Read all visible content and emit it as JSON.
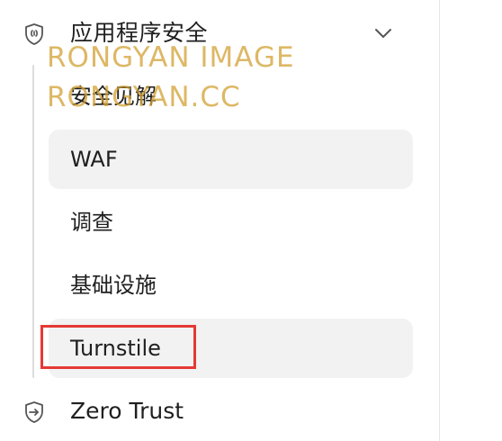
{
  "sidebar": {
    "section": {
      "title": "应用程序安全",
      "icon": "shield-icon",
      "expanded": true
    },
    "items": [
      {
        "label": "安全见解",
        "active": false
      },
      {
        "label": "WAF",
        "active": true
      },
      {
        "label": "调查",
        "active": false
      },
      {
        "label": "基础设施",
        "active": false
      },
      {
        "label": "Turnstile",
        "active": true,
        "highlighted": true
      }
    ],
    "next_section": {
      "title": "Zero Trust",
      "icon": "shield-arrow-icon"
    }
  },
  "watermark": {
    "line1": "RONGYAN IMAGE",
    "line2": "RONGYAN.CC"
  },
  "colors": {
    "highlight_border": "#e53935",
    "active_bg": "#f2f2f2",
    "text": "#1f1f1f",
    "watermark": "#d2a032"
  }
}
